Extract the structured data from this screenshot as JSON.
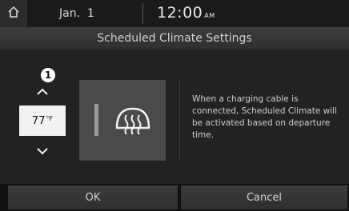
{
  "status": {
    "date": "Jan.  1",
    "time": "12:00",
    "ampm": "AM"
  },
  "screen": {
    "title": "Scheduled Climate Settings"
  },
  "temperature": {
    "value": "77",
    "unit": "°F"
  },
  "callout": "1",
  "info_text": "When a charging cable is connected, Scheduled Climate will be activated based on departure time.",
  "buttons": {
    "ok": "OK",
    "cancel": "Cancel"
  },
  "icons": {
    "home": "home-icon",
    "up": "chevron-up-icon",
    "down": "chevron-down-icon",
    "defrost": "front-defrost-icon"
  }
}
